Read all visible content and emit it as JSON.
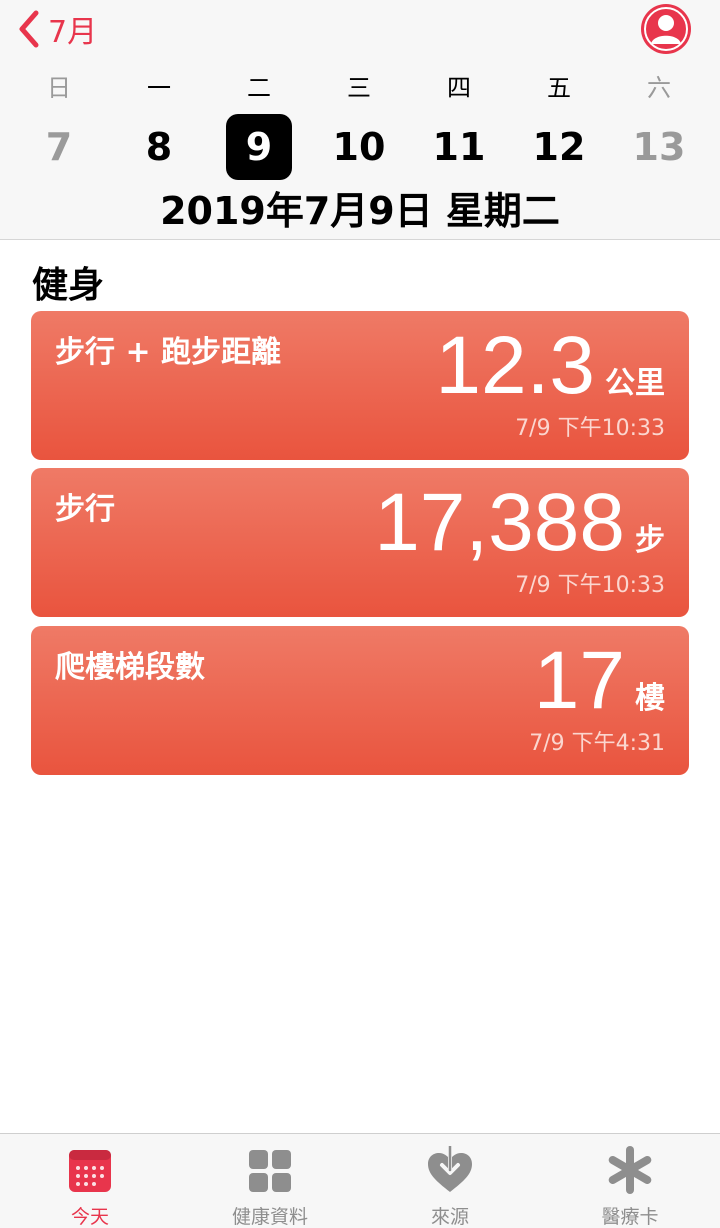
{
  "header": {
    "back_label": "7月",
    "weekdays": [
      "日",
      "一",
      "二",
      "三",
      "四",
      "五",
      "六"
    ],
    "days": [
      "7",
      "8",
      "9",
      "10",
      "11",
      "12",
      "13"
    ],
    "selected_day": "9",
    "date_line": "2019年7月9日 星期二"
  },
  "section": {
    "title": "健身"
  },
  "cards": [
    {
      "label": "步行 + 跑步距離",
      "value": "12.3",
      "unit": "公里",
      "time": "7/9 下午10:33"
    },
    {
      "label": "步行",
      "value": "17,388",
      "unit": "步",
      "time": "7/9 下午10:33"
    },
    {
      "label": "爬樓梯段數",
      "value": "17",
      "unit": "樓",
      "time": "7/9 下午4:31"
    }
  ],
  "tabs": [
    {
      "label": "今天",
      "icon": "calendar-today-icon"
    },
    {
      "label": "健康資料",
      "icon": "grid-icon"
    },
    {
      "label": "來源",
      "icon": "heart-download-icon"
    },
    {
      "label": "醫療卡",
      "icon": "asterisk-icon"
    }
  ],
  "colors": {
    "accent": "#e8354c",
    "card_top": "#ef7a66",
    "card_bottom": "#e9543e",
    "tab_inactive": "#8e8e8e"
  }
}
